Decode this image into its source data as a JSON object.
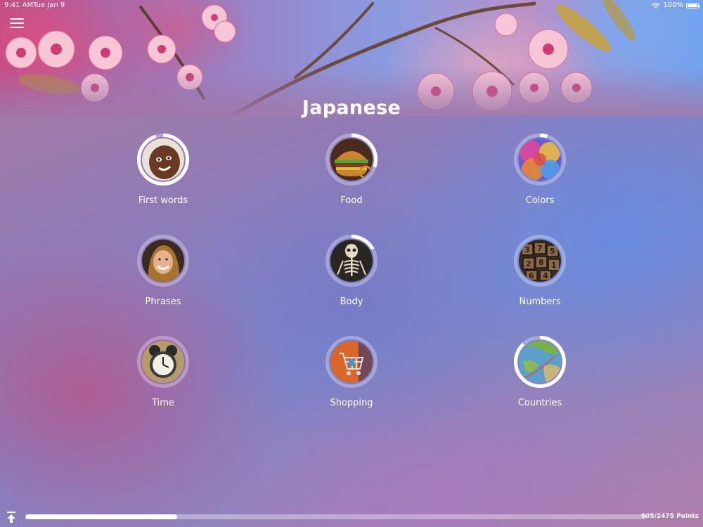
{
  "status_bar": {
    "time": "9:41 AM",
    "date": "Tue Jan 9",
    "battery": "100%",
    "wifi_icon": "wifi-icon",
    "battery_icon": "battery-icon"
  },
  "header": {
    "menu_icon": "hamburger-menu-icon",
    "title": "Japanese"
  },
  "categories": [
    {
      "label": "First words",
      "progress": 0.95,
      "image": "child-face"
    },
    {
      "label": "Food",
      "progress": 0.3,
      "image": "burger"
    },
    {
      "label": "Colors",
      "progress": 0.05,
      "image": "color-powder"
    },
    {
      "label": "Phrases",
      "progress": 0.0,
      "image": "smiling-woman"
    },
    {
      "label": "Body",
      "progress": 0.17,
      "image": "skeleton"
    },
    {
      "label": "Numbers",
      "progress": 0.0,
      "image": "letterpress-numbers"
    },
    {
      "label": "Time",
      "progress": 0.0,
      "image": "alarm-clock"
    },
    {
      "label": "Shopping",
      "progress": 0.0,
      "image": "shopping-cart"
    },
    {
      "label": "Countries",
      "progress": 0.88,
      "image": "world-map"
    }
  ],
  "footer": {
    "scroll_top_icon": "arrow-up-to-top-icon",
    "progress": 0.244,
    "points_text": "605/2475 Points"
  }
}
